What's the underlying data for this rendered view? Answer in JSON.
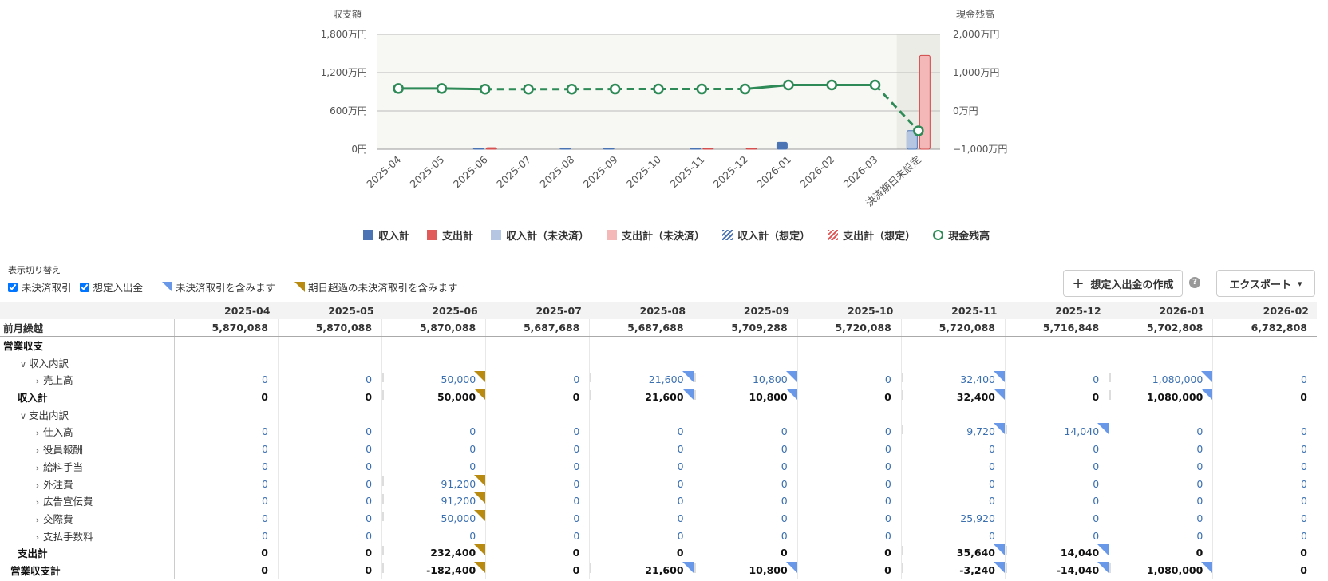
{
  "chart_data": {
    "type": "bar",
    "categories": [
      "2025-04",
      "2025-05",
      "2025-06",
      "2025-07",
      "2025-08",
      "2025-09",
      "2025-10",
      "2025-11",
      "2025-12",
      "2026-01",
      "2026-02",
      "2026-03",
      "決済期日未設定"
    ],
    "y_left_label": "収支額",
    "y_right_label": "現金残高",
    "y_left_ticks": [
      "1,800万円",
      "1,200万円",
      "600万円",
      "0円"
    ],
    "y_right_ticks": [
      "2,000万円",
      "1,000万円",
      "0万円",
      "−1,000万円"
    ],
    "ylim_left": [
      0,
      1800
    ],
    "ylim_right": [
      -1000,
      2000
    ],
    "series": [
      {
        "name": "収入計",
        "values": [
          0,
          0,
          5,
          0,
          2,
          1,
          0,
          3,
          0,
          108,
          0,
          0,
          0
        ],
        "color": "#4a74b4"
      },
      {
        "name": "支出計",
        "values": [
          0,
          0,
          23,
          0,
          0,
          0,
          0,
          4,
          1,
          0,
          0,
          0,
          0
        ],
        "color": "#e05a5a"
      },
      {
        "name": "収入計（未決済）",
        "values": [
          0,
          0,
          0,
          0,
          0,
          0,
          0,
          0,
          0,
          0,
          0,
          0,
          290
        ],
        "color": "#b4c6e2"
      },
      {
        "name": "支出計（未決済）",
        "values": [
          0,
          0,
          0,
          0,
          0,
          0,
          0,
          0,
          0,
          0,
          0,
          0,
          1470
        ],
        "color": "#f4b8b8"
      },
      {
        "name": "現金残高",
        "values": [
          587,
          587,
          569,
          569,
          569,
          572,
          572,
          572,
          572,
          678,
          678,
          678,
          -520
        ],
        "color": "#2e8b57"
      }
    ],
    "legend": [
      {
        "name": "収入計",
        "style": "solid",
        "color": "#4a74b4"
      },
      {
        "name": "支出計",
        "style": "solid",
        "color": "#e05a5a"
      },
      {
        "name": "収入計（未決済）",
        "style": "solid",
        "color": "#b4c6e2"
      },
      {
        "name": "支出計（未決済）",
        "style": "solid",
        "color": "#f4b8b8"
      },
      {
        "name": "収入計（想定）",
        "style": "hatch",
        "color": "#4a74b4"
      },
      {
        "name": "支出計（想定）",
        "style": "hatch",
        "color": "#e05a5a"
      },
      {
        "name": "現金残高",
        "style": "circle",
        "color": "#2e8b57"
      }
    ],
    "legend_position": "bottom",
    "grid": true
  },
  "controls": {
    "toggle_title": "表示切り替え",
    "unsettled_label": "未決済取引",
    "planned_label": "想定入出金",
    "note_blue": "未決済取引を含みます",
    "note_gold": "期日超過の未決済取引を含みます",
    "create_label": "想定入出金の作成",
    "export_label": "エクスポート",
    "help": "?",
    "plus": "+",
    "caret": "▾",
    "colors": {
      "blue": "#6a98e8",
      "gold": "#b88a10"
    }
  },
  "table": {
    "months": [
      "2025-04",
      "2025-05",
      "2025-06",
      "2025-07",
      "2025-08",
      "2025-09",
      "2025-10",
      "2025-11",
      "2025-12",
      "2026-01",
      "2026-02"
    ],
    "carry": {
      "label": "前月繰越",
      "values": [
        "5,870,088",
        "5,870,088",
        "5,870,088",
        "5,687,688",
        "5,687,688",
        "5,709,288",
        "5,720,088",
        "5,720,088",
        "5,716,848",
        "5,702,808",
        "6,782,808"
      ]
    },
    "rows": [
      {
        "label": "営業収支",
        "indent": 0,
        "chev": "",
        "bold": true,
        "values": []
      },
      {
        "label": "収入内訳",
        "indent": 1,
        "chev": "∨",
        "bold": false,
        "values": []
      },
      {
        "label": "売上高",
        "indent": 2,
        "chev": "›",
        "bold": false,
        "link": true,
        "values": [
          "0",
          "0",
          "50,000",
          "0",
          "21,600",
          "10,800",
          "0",
          "32,400",
          "0",
          "1,080,000",
          "0"
        ],
        "marks": [
          "",
          "",
          "gold",
          "",
          "blue",
          "blue",
          "",
          "blue",
          "",
          "blue",
          ""
        ]
      },
      {
        "label": "収入計",
        "indent": 1,
        "chev": "",
        "bold": true,
        "values": [
          "0",
          "0",
          "50,000",
          "0",
          "21,600",
          "10,800",
          "0",
          "32,400",
          "0",
          "1,080,000",
          "0"
        ],
        "marks": [
          "",
          "",
          "gold",
          "",
          "blue",
          "blue",
          "",
          "blue",
          "",
          "blue",
          ""
        ]
      },
      {
        "label": "支出内訳",
        "indent": 1,
        "chev": "∨",
        "bold": false,
        "values": []
      },
      {
        "label": "仕入高",
        "indent": 2,
        "chev": "›",
        "bold": false,
        "link": true,
        "values": [
          "0",
          "0",
          "0",
          "0",
          "0",
          "0",
          "0",
          "9,720",
          "14,040",
          "0",
          "0"
        ],
        "marks": [
          "",
          "",
          "",
          "",
          "",
          "",
          "",
          "blue",
          "blue",
          "",
          ""
        ]
      },
      {
        "label": "役員報酬",
        "indent": 2,
        "chev": "›",
        "bold": false,
        "link": true,
        "values": [
          "0",
          "0",
          "0",
          "0",
          "0",
          "0",
          "0",
          "0",
          "0",
          "0",
          "0"
        ],
        "marks": []
      },
      {
        "label": "給料手当",
        "indent": 2,
        "chev": "›",
        "bold": false,
        "link": true,
        "values": [
          "0",
          "0",
          "0",
          "0",
          "0",
          "0",
          "0",
          "0",
          "0",
          "0",
          "0"
        ],
        "marks": []
      },
      {
        "label": "外注費",
        "indent": 2,
        "chev": "›",
        "bold": false,
        "link": true,
        "values": [
          "0",
          "0",
          "91,200",
          "0",
          "0",
          "0",
          "0",
          "0",
          "0",
          "0",
          "0"
        ],
        "marks": [
          "",
          "",
          "gold",
          "",
          "",
          "",
          "",
          "",
          "",
          "",
          ""
        ]
      },
      {
        "label": "広告宣伝費",
        "indent": 2,
        "chev": "›",
        "bold": false,
        "link": true,
        "values": [
          "0",
          "0",
          "91,200",
          "0",
          "0",
          "0",
          "0",
          "0",
          "0",
          "0",
          "0"
        ],
        "marks": [
          "",
          "",
          "gold",
          "",
          "",
          "",
          "",
          "",
          "",
          "",
          ""
        ]
      },
      {
        "label": "交際費",
        "indent": 2,
        "chev": "›",
        "bold": false,
        "link": true,
        "values": [
          "0",
          "0",
          "50,000",
          "0",
          "0",
          "0",
          "0",
          "25,920",
          "0",
          "0",
          "0"
        ],
        "marks": [
          "",
          "",
          "gold",
          "",
          "",
          "",
          "",
          "",
          "",
          "",
          ""
        ]
      },
      {
        "label": "支払手数料",
        "indent": 2,
        "chev": "›",
        "bold": false,
        "link": true,
        "values": [
          "0",
          "0",
          "0",
          "0",
          "0",
          "0",
          "0",
          "0",
          "0",
          "0",
          "0"
        ],
        "marks": []
      },
      {
        "label": "支出計",
        "indent": 1,
        "chev": "",
        "bold": true,
        "values": [
          "0",
          "0",
          "232,400",
          "0",
          "0",
          "0",
          "0",
          "35,640",
          "14,040",
          "0",
          "0"
        ],
        "marks": [
          "",
          "",
          "gold",
          "",
          "",
          "",
          "",
          "blue",
          "blue",
          "",
          ""
        ]
      },
      {
        "label": "営業収支計",
        "indent": 0.5,
        "chev": "",
        "bold": true,
        "values": [
          "0",
          "0",
          "-182,400",
          "0",
          "21,600",
          "10,800",
          "0",
          "-3,240",
          "-14,040",
          "1,080,000",
          "0"
        ],
        "marks": [
          "",
          "",
          "gold",
          "",
          "blue",
          "blue",
          "",
          "blue",
          "blue",
          "blue",
          ""
        ]
      }
    ]
  }
}
